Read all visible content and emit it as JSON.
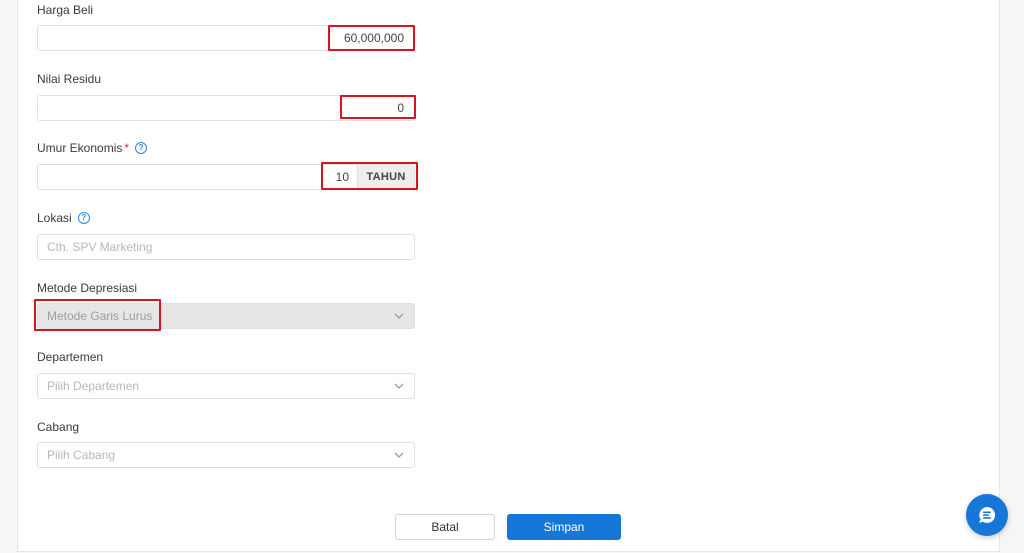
{
  "form": {
    "purchase_price": {
      "label": "Harga Beli",
      "value": "60,000,000"
    },
    "residual_value": {
      "label": "Nilai Residu",
      "value": "0"
    },
    "economic_life": {
      "label": "Umur Ekonomis",
      "required_mark": "*",
      "help_icon": "question-circle-icon",
      "value": "10",
      "unit": "TAHUN"
    },
    "location": {
      "label": "Lokasi",
      "help_icon": "question-circle-icon",
      "placeholder": "Cth. SPV Marketing"
    },
    "depreciation_method": {
      "label": "Metode Depresiasi",
      "value": "Metode Garis Lurus"
    },
    "department": {
      "label": "Departemen",
      "placeholder": "Pilih Departemen"
    },
    "branch": {
      "label": "Cabang",
      "placeholder": "Pilih Cabang"
    }
  },
  "actions": {
    "cancel_label": "Batal",
    "save_label": "Simpan"
  },
  "colors": {
    "primary": "#1677d8",
    "highlight": "#d8141f",
    "required": "#e0263a",
    "help": "#2b8ae0"
  },
  "icons": {
    "chat": "chat-bubble-icon",
    "dropdown": "chevron-down-icon"
  }
}
